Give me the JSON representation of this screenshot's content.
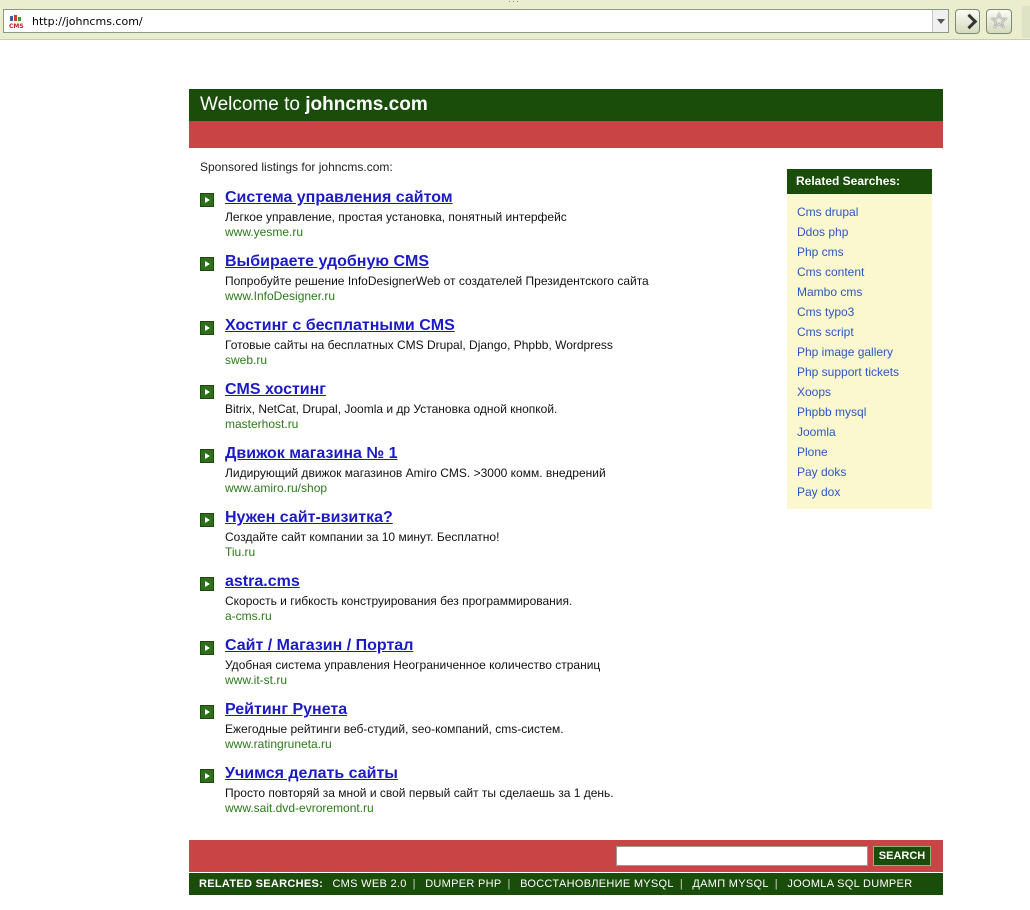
{
  "browser": {
    "url": "http://johncms.com/",
    "favicon_text": "CMS"
  },
  "header": {
    "prefix": "Welcome to ",
    "domain": "johncms.com"
  },
  "sponsored_label": "Sponsored listings for johncms.com:",
  "listings": [
    {
      "title": "Система управления сайтом",
      "desc": "Легкое управление, простая установка, понятный интерфейс",
      "url": "www.yesme.ru"
    },
    {
      "title": "Выбираете удобную CMS",
      "desc": "Попробуйте решение InfoDesignerWeb от создателей Президентского сайта",
      "url": "www.InfoDesigner.ru"
    },
    {
      "title": "Хостинг с бесплатными CMS",
      "desc": "Готовые сайты на бесплатных CMS Drupal, Django, Phpbb, Wordpress",
      "url": "sweb.ru"
    },
    {
      "title": "CMS хостинг",
      "desc": "Bitrix, NetCat, Drupal, Joomla и др Установка одной кнопкой.",
      "url": "masterhost.ru"
    },
    {
      "title": "Движок магазина № 1",
      "desc": "Лидирующий движок магазинов Amiro CMS. >3000 комм. внедрений",
      "url": "www.amiro.ru/shop"
    },
    {
      "title": "Нужен сайт-визитка?",
      "desc": "Создайте сайт компании за 10 минут. Бесплатно!",
      "url": "Tiu.ru"
    },
    {
      "title": "astra.cms",
      "desc": "Скорость и гибкость конструирования без программирования.",
      "url": "a-cms.ru"
    },
    {
      "title": "Сайт / Магазин / Портал",
      "desc": "Удобная система управления Неограниченное количество страниц",
      "url": "www.it-st.ru"
    },
    {
      "title": "Рейтинг Рунета",
      "desc": "Ежегодные рейтинги веб-студий, seo-компаний, cms-систем.",
      "url": "www.ratingruneta.ru"
    },
    {
      "title": "Учимся делать сайты",
      "desc": "Просто повторяй за мной и свой первый сайт ты сделаешь за 1 день.",
      "url": "www.sait.dvd-evroremont.ru"
    }
  ],
  "related": {
    "heading": "Related Searches:",
    "items": [
      "Cms drupal",
      "Ddos php",
      "Php cms",
      "Cms content",
      "Mambo cms",
      "Cms typo3",
      "Cms script",
      "Php image gallery",
      "Php support tickets",
      "Xoops",
      "Phpbb mysql",
      "Joomla",
      "Plone",
      "Pay doks",
      "Pay dox"
    ]
  },
  "search": {
    "input_value": "",
    "button_label": "SEARCH"
  },
  "bottom_related": {
    "label": "RELATED SEARCHES:",
    "items": [
      "CMS WEB 2.0",
      "DUMPER PHP",
      "ВОССТАНОВЛЕНИЕ MYSQL",
      "ДАМП MYSQL",
      "JOOMLA SQL DUMPER"
    ]
  }
}
